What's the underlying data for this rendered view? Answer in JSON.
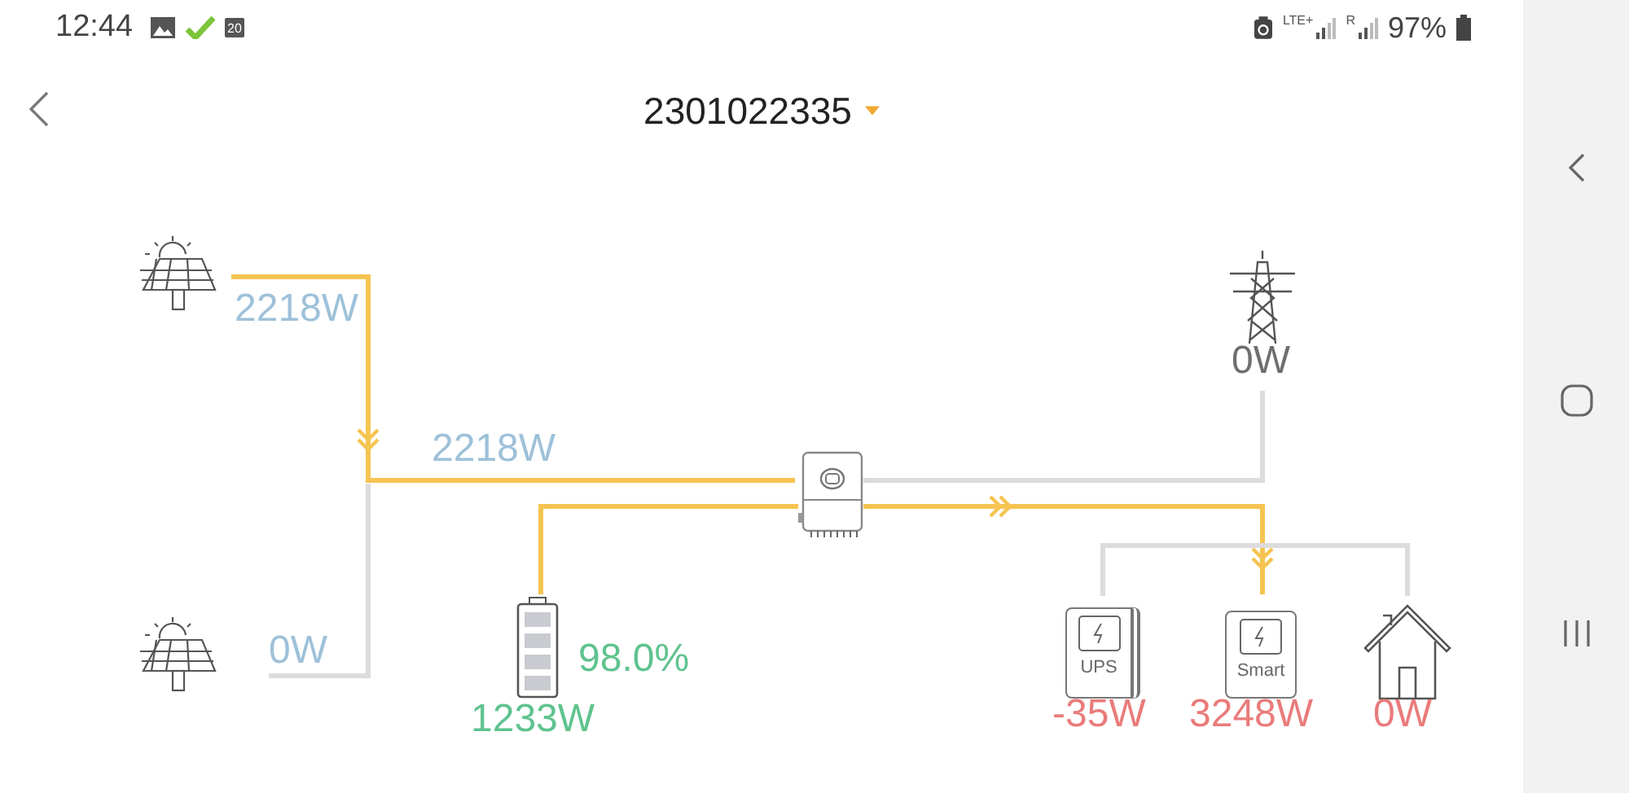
{
  "status_bar": {
    "time": "12:44",
    "calendar_day": "20",
    "network": "LTE+",
    "roaming": "R",
    "battery": "97%"
  },
  "header": {
    "title": "2301022335"
  },
  "pv_total": "2218W",
  "nodes": [
    {
      "kind": "pv",
      "power": "2218W"
    },
    {
      "kind": "pv",
      "power": "0W"
    },
    {
      "kind": "battery",
      "power": "1233W",
      "soc": "98.0%"
    },
    {
      "kind": "grid",
      "power": "0W"
    },
    {
      "kind": "ups",
      "power": "-35W",
      "label": "UPS"
    },
    {
      "kind": "smart",
      "power": "3248W",
      "label": "Smart"
    },
    {
      "kind": "home",
      "power": "0W"
    }
  ],
  "lines": [
    {
      "active": true
    },
    {
      "active": false
    },
    {
      "active": true
    },
    {
      "active": false
    },
    {
      "active": true
    },
    {
      "active": false
    }
  ]
}
